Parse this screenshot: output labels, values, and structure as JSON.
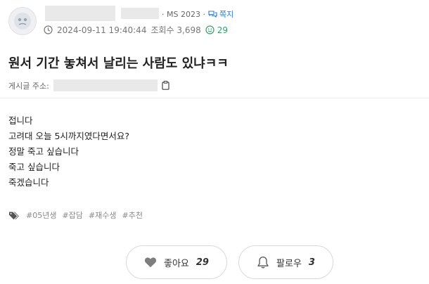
{
  "header": {
    "meta_tag": "· MS 2023 ·",
    "note_label": "쪽지",
    "datetime": "2024-09-11 19:40:44",
    "views_label": "조회수 3,698",
    "score": "29"
  },
  "post": {
    "title": "원서 기간 놓쳐서 날리는 사람도 있냐ㅋㅋ",
    "address_label": "게시글 주소:",
    "body_lines": [
      "접니다",
      "고려대 오늘 5시까지였다면서요?",
      "정말 죽고 싶습니다",
      "죽고 싶습니다",
      "죽겠습니다"
    ],
    "tags": [
      "#05년생",
      "#잡담",
      "#재수생",
      "#추천"
    ]
  },
  "actions": {
    "like_label": "좋아요",
    "like_count": "29",
    "follow_label": "팔로우",
    "follow_count": "3"
  },
  "icons": {
    "note": "chat-bubbles-icon",
    "clock": "clock-icon",
    "score": "smile-icon",
    "copy": "clipboard-icon",
    "tags": "tags-icon",
    "like": "heart-icon",
    "follow": "bell-icon"
  },
  "colors": {
    "link_blue": "#2c78d3",
    "score_green": "#2fa36b"
  }
}
